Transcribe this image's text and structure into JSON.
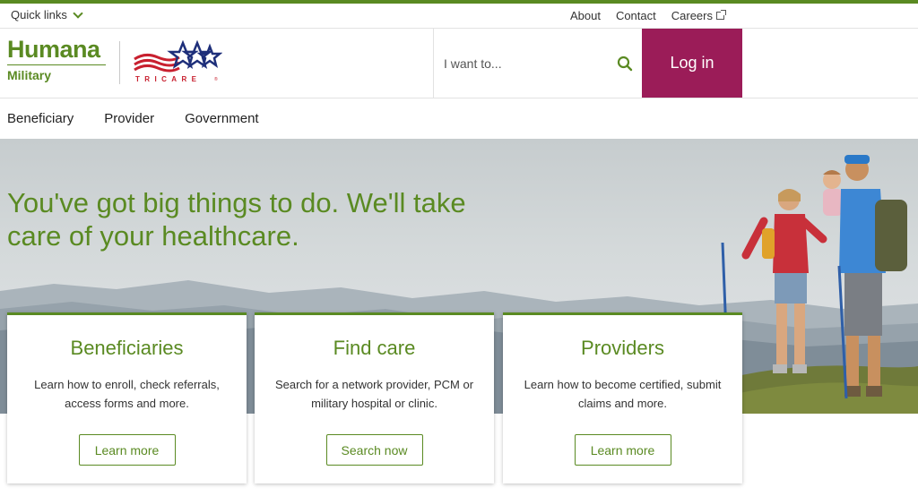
{
  "utility": {
    "quick_links": "Quick links",
    "about": "About",
    "contact": "Contact",
    "careers": "Careers"
  },
  "brand": {
    "name": "Humana",
    "sub": "Military",
    "partner": "TRICARE",
    "partner_mark": "®"
  },
  "search": {
    "placeholder": "I want to..."
  },
  "login": {
    "label": "Log in"
  },
  "nav": {
    "items": [
      "Beneficiary",
      "Provider",
      "Government"
    ]
  },
  "hero": {
    "title": "You've got big things to do. We'll take care of your healthcare."
  },
  "cards": [
    {
      "title": "Beneficiaries",
      "text": "Learn how to enroll, check referrals, access forms and more.",
      "button": "Learn more"
    },
    {
      "title": "Find care",
      "text": "Search for a network provider, PCM or military hospital or clinic.",
      "button": "Search now"
    },
    {
      "title": "Providers",
      "text": "Learn how to become certified, submit claims and more.",
      "button": "Learn more"
    }
  ],
  "colors": {
    "brand_green": "#5a8a22",
    "login_bg": "#9b1c58",
    "tricare_red": "#c8202f",
    "tricare_blue": "#1e2f7a"
  },
  "icons": {
    "quick_links": "chevron-down-icon",
    "careers": "external-link-icon",
    "search": "search-icon"
  }
}
